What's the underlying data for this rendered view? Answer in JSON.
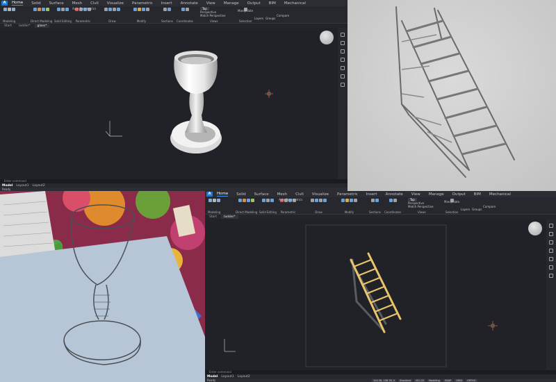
{
  "app": {
    "menu_tabs": [
      "Home",
      "Solid",
      "Surface",
      "Mesh",
      "Civil",
      "Visualize",
      "Parametric",
      "Insert",
      "Annotate",
      "View",
      "Manage",
      "Output",
      "BIM",
      "Mechanical"
    ],
    "active_menu_tab": "Home",
    "ribbon_groups": [
      "Modeling",
      "Direct Modeling",
      "Solid Editing",
      "Parametric",
      "Draw",
      "Modify",
      "Sections",
      "Coordinates",
      "Views",
      "Selection"
    ],
    "ribbon_buttons": {
      "auto_parametrics": "Auto Parametrics",
      "view_top": "Top",
      "perspective_one": "Perspective",
      "perspective_two": "Match Perspective",
      "layers": "Layers",
      "groups": "Groups",
      "compare": "Compare",
      "manipulate": "Manipulate"
    },
    "command_label": "Enter command",
    "layout_tabs": [
      "Model",
      "Layout1",
      "Layout2"
    ],
    "status_ready": "Ready",
    "status_coords": "104.36, 108.76, 0",
    "status_toggles": [
      "Standard",
      "ISO-25",
      "Modeling",
      "SNAP",
      "GRID",
      "ORTHO",
      "POLAR",
      "ESNAP",
      "STRACK",
      "LWT",
      "TILE",
      "DUCS",
      "DYN",
      "QUAD",
      "RT",
      "HKA"
    ]
  },
  "top_left": {
    "doc_tabs": [
      "Start",
      "ladder*",
      "glass*"
    ],
    "active_doc": "glass*"
  },
  "bottom_right": {
    "doc_tabs": [
      "Start",
      "ladder*"
    ],
    "active_doc": "ladder*"
  },
  "colors": {
    "accent": "#3c8ff0",
    "ladder_face": "#e8c46a",
    "ladder_shadow": "#595b61",
    "viewport_bg": "#202228",
    "photo_paper": "#d0cfcd"
  },
  "photos": {
    "top_right": "Pencil sketch of a ladder on paper",
    "bottom_left": "Pencil sketch of a wine glass on paper with colorful tablecloth"
  }
}
